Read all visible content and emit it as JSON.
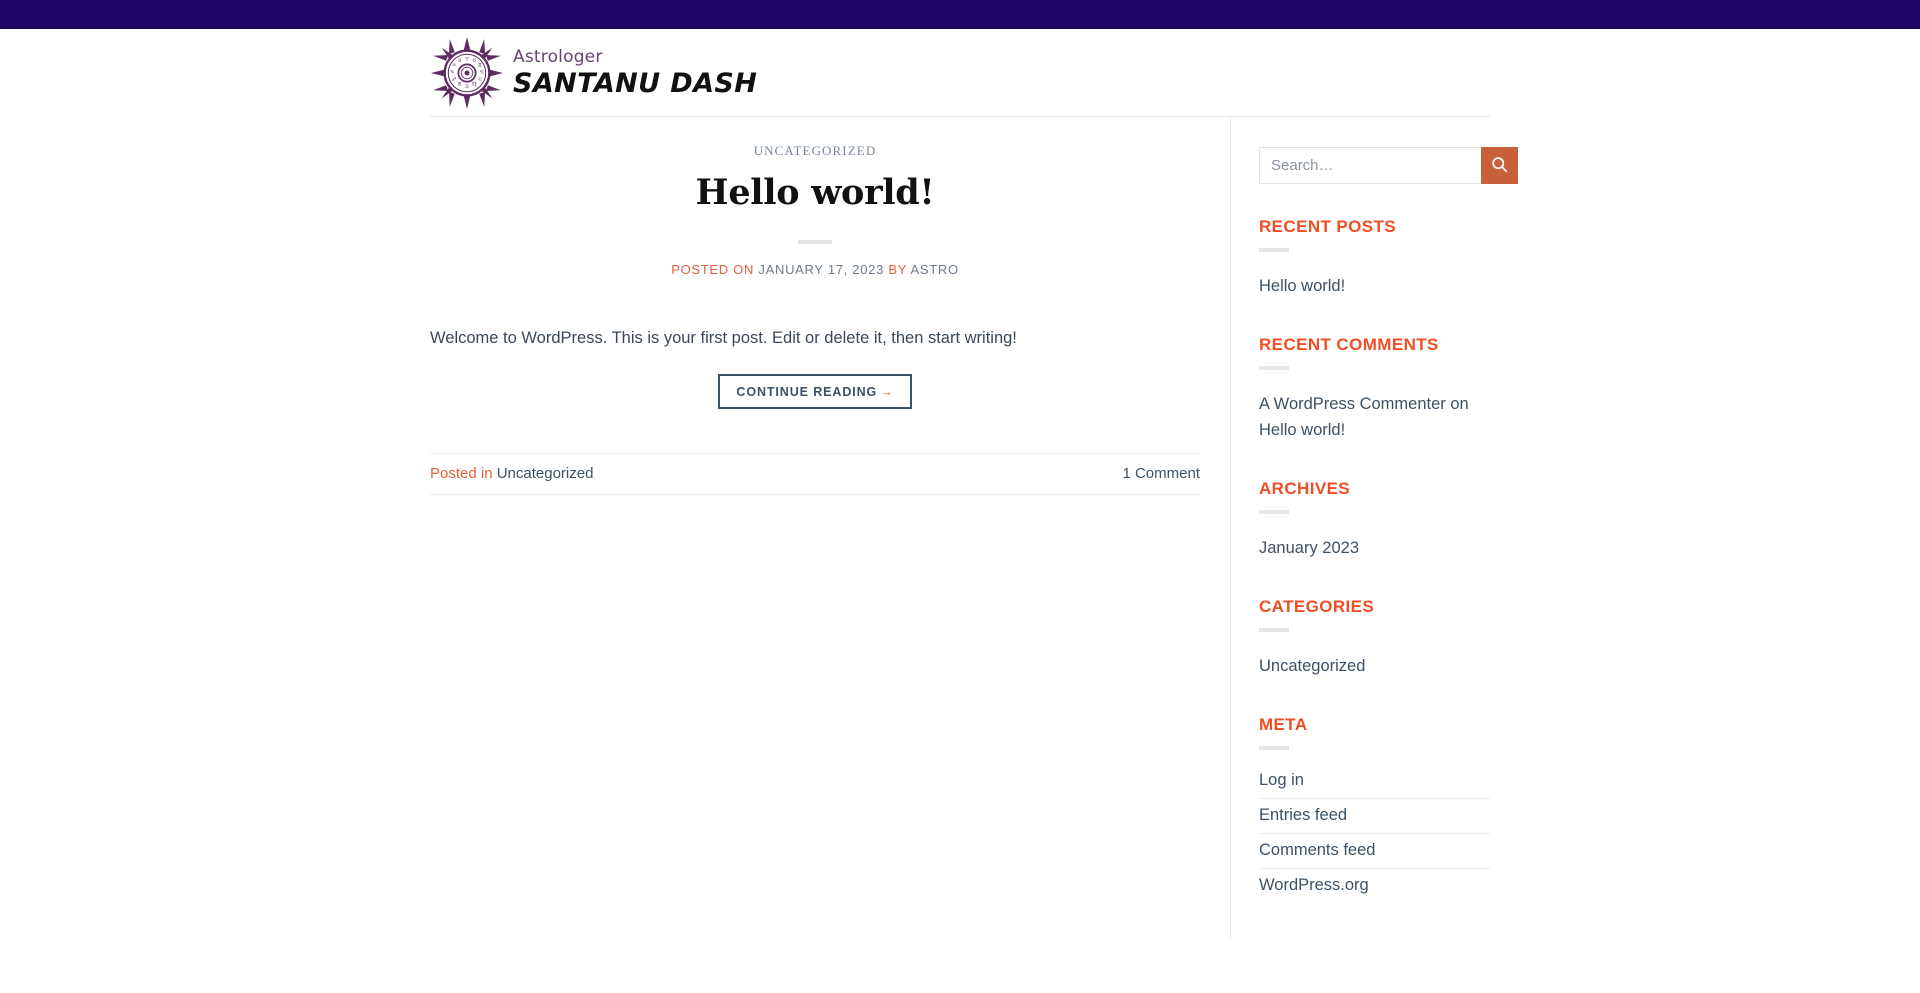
{
  "topbar": {
    "color": "#1F0566"
  },
  "header": {
    "logo_icon": "zodiac-sun-icon",
    "brand_sub": "Astrologer",
    "brand_main": "SANTANU DASH"
  },
  "post": {
    "category_label": "UNCATEGORIZED",
    "title": "Hello world!",
    "meta_posted_on": "POSTED ON",
    "meta_date": "JANUARY 17, 2023",
    "meta_by": "BY",
    "meta_author": "ASTRO",
    "excerpt": "Welcome to WordPress. This is your first post. Edit or delete it, then start writing!",
    "read_more_label": "CONTINUE READING",
    "read_more_arrow": "→",
    "posted_in_label": "Posted in",
    "posted_in_value": "Uncategorized",
    "comment_count": "1 Comment"
  },
  "sidebar": {
    "search": {
      "placeholder": "Search…",
      "value": "",
      "button_icon": "search-icon"
    },
    "widgets": [
      {
        "title": "RECENT POSTS",
        "items": [
          "Hello world!"
        ]
      },
      {
        "title": "RECENT COMMENTS",
        "comment_author": "A WordPress Commenter",
        "comment_on": "on",
        "comment_post": "Hello world!"
      },
      {
        "title": "ARCHIVES",
        "items": [
          "January 2023"
        ]
      },
      {
        "title": "CATEGORIES",
        "items": [
          "Uncategorized"
        ]
      },
      {
        "title": "META",
        "items": [
          "Log in",
          "Entries feed",
          "Comments feed",
          "WordPress.org"
        ]
      }
    ]
  },
  "colors": {
    "topbar_purple": "#1F0566",
    "accent_orange": "#F04E23",
    "meta_orange": "#E8613A",
    "search_button": "#C9603C",
    "slate": "#3D5166",
    "logo_purple": "#5E2B63"
  }
}
